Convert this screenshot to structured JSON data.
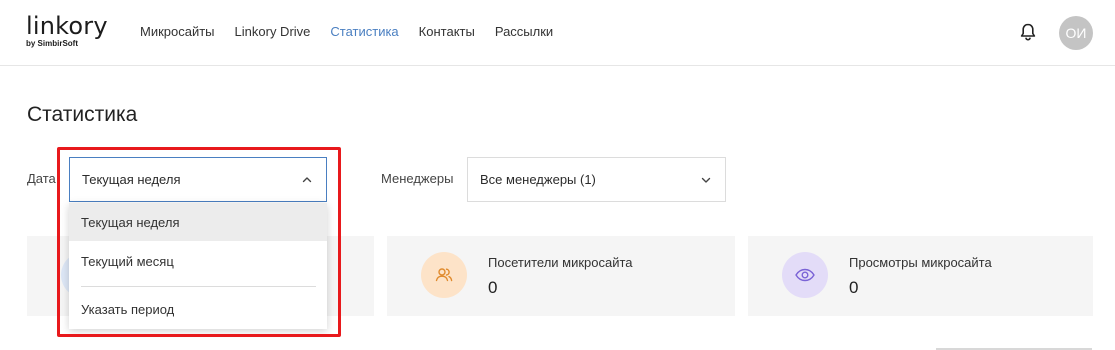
{
  "header": {
    "logo": "linkory",
    "logo_sub": "by SimbirSoft",
    "nav": [
      {
        "label": "Микросайты",
        "active": false
      },
      {
        "label": "Linkory Drive",
        "active": false
      },
      {
        "label": "Статистика",
        "active": true
      },
      {
        "label": "Контакты",
        "active": false
      },
      {
        "label": "Рассылки",
        "active": false
      }
    ],
    "avatar_initials": "ОИ"
  },
  "page": {
    "title": "Статистика"
  },
  "filters": {
    "date_label": "Дата",
    "date_value": "Текущая неделя",
    "managers_label": "Менеджеры",
    "managers_value": "Все менеджеры (1)"
  },
  "dropdown": {
    "items": [
      {
        "label": "Текущая неделя",
        "selected": true
      },
      {
        "label": "Текущий месяц",
        "selected": false
      },
      {
        "label": "Указать период",
        "selected": false
      }
    ]
  },
  "cards": [
    {
      "label": "",
      "value": "",
      "icon": "chart-icon"
    },
    {
      "label": "Посетители микросайта",
      "value": "0",
      "icon": "users-icon"
    },
    {
      "label": "Просмотры микросайта",
      "value": "0",
      "icon": "eye-icon"
    }
  ],
  "colors": {
    "accent": "#4a7fc1",
    "highlight": "#e8191c",
    "card_bg": "#f5f5f5",
    "orange_icon_bg": "#fde3c8",
    "purple_icon_bg": "#e3dcf8"
  }
}
